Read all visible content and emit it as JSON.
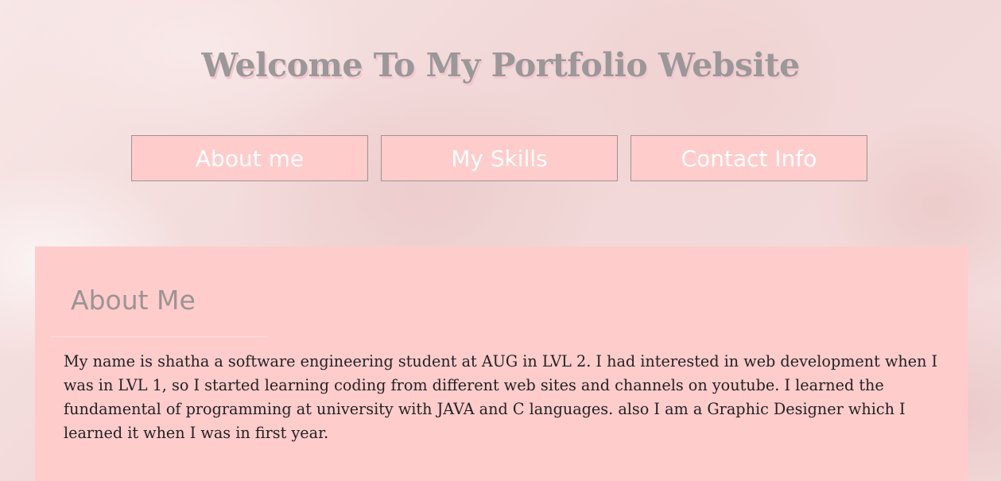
{
  "header": {
    "title": "Welcome To My Portfolio Website"
  },
  "nav": {
    "items": [
      {
        "label": "About me"
      },
      {
        "label": "My Skills"
      },
      {
        "label": "Contact Info"
      }
    ]
  },
  "about": {
    "heading": "About Me",
    "paragraph": "My name is shatha a software engineering student at AUG in LVL 2. I had interested in web development when I was in LVL 1, so I started learning coding from different web sites and channels on youtube. I learned the fundamental of programming at university with JAVA and C languages. also I am a Graphic Designer which I learned it when I was in first year."
  },
  "colors": {
    "background": "#f6e3e3",
    "panel": "#ffcccc",
    "title_text": "#9a9898",
    "title_shadow": "#f2c7cf",
    "button_text": "#ffffff",
    "body_text": "#222222"
  }
}
